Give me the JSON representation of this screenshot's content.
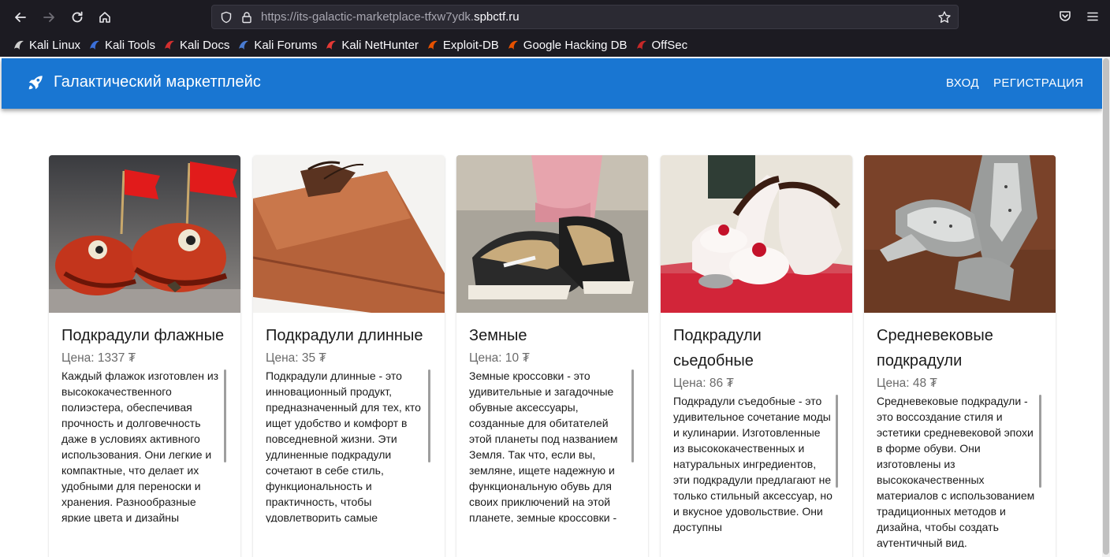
{
  "browser": {
    "url_dim": "https://its-galactic-marketplace-tfxw7ydk.",
    "url_host": "spbctf.ru",
    "bookmarks": [
      {
        "label": "Kali Linux",
        "icon": "kali-dragon-icon",
        "color": "#cfcfcf"
      },
      {
        "label": "Kali Tools",
        "icon": "kali-tools-icon",
        "color": "#3b6fd8"
      },
      {
        "label": "Kali Docs",
        "icon": "kali-docs-icon",
        "color": "#d32f2f"
      },
      {
        "label": "Kali Forums",
        "icon": "kali-forums-icon",
        "color": "#4a7bd1"
      },
      {
        "label": "Kali NetHunter",
        "icon": "kali-nethunter-icon",
        "color": "#e53935"
      },
      {
        "label": "Exploit-DB",
        "icon": "exploit-db-icon",
        "color": "#e65100"
      },
      {
        "label": "Google Hacking DB",
        "icon": "ghdb-icon",
        "color": "#e65100"
      },
      {
        "label": "OffSec",
        "icon": "offsec-icon",
        "color": "#c62828"
      }
    ]
  },
  "app": {
    "title": "Галактический маркетплейс",
    "brand_color": "#1976d2",
    "nav": {
      "login": "Вход",
      "register": "Регистрация"
    }
  },
  "products": [
    {
      "title_lines": [
        "Подкрадули флажные"
      ],
      "price": "Цена: 1337 ₮",
      "description": "Каждый флажок изготовлен из высококачественного полиэстера, обеспечивая прочность и долговечность даже в условиях активного использования. Они легкие и компактные, что делает их удобными для переноски и хранения. Разнообразные яркие цвета и дизайны"
    },
    {
      "title_lines": [
        "Подкрадули длинные"
      ],
      "price": "Цена: 35 ₮",
      "description": "Подкрадули длинные - это инновационный продукт, предназначенный для тех, кто ищет удобство и комфорт в повседневной жизни. Эти удлиненные подкрадули сочетают в себе стиль, функциональность и практичность, чтобы удовлетворить самые"
    },
    {
      "title_lines": [
        "Земные"
      ],
      "price": "Цена: 10 ₮",
      "description": "Земные кроссовки - это удивительные и загадочные обувные аксессуары, созданные для обитателей этой планеты под названием Земля. Так что, если вы, земляне, ищете надежную и функциональную обувь для своих приключений на этой планете, земные кроссовки -"
    },
    {
      "title_lines": [
        "Подкрадули",
        "сьедобные"
      ],
      "price": "Цена: 86 ₮",
      "description": "Подкрадули съедобные - это удивительное сочетание моды и кулинарии. Изготовленные из высококачественных и натуральных ингредиентов, эти подкрадули предлагают не только стильный аксессуар, но и вкусное удовольствие. Они доступны"
    },
    {
      "title_lines": [
        "Средневековые",
        "подкрадули"
      ],
      "price": "Цена: 48 ₮",
      "description": "Средневековые подкрадули - это воссоздание стиля и эстетики средневековой эпохи в форме обуви. Они изготовлены из высококачественных материалов с использованием традиционных методов и дизайна, чтобы создать аутентичный вид."
    }
  ]
}
